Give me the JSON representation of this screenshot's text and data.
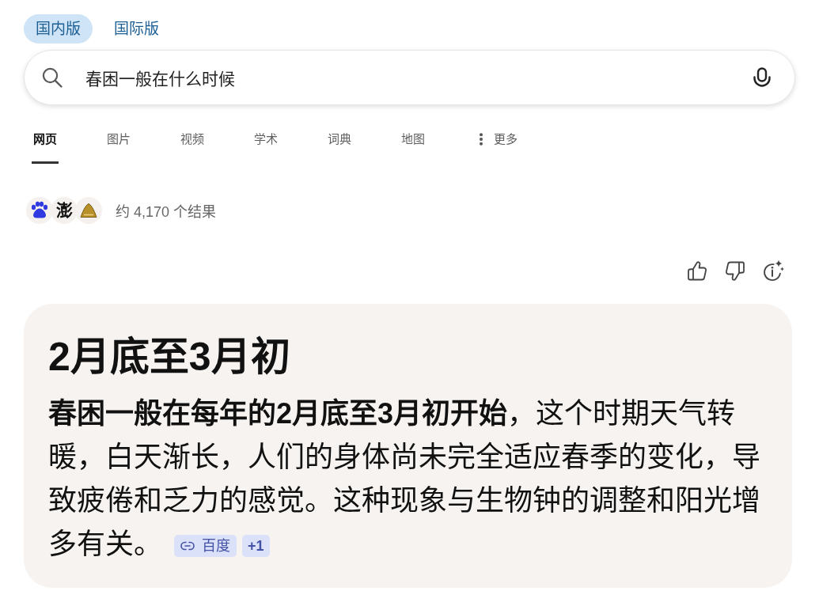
{
  "edition_tabs": [
    {
      "label": "国内版",
      "selected": true
    },
    {
      "label": "国际版",
      "selected": false
    }
  ],
  "search": {
    "value": "春困一般在什么时候"
  },
  "nav_tabs": [
    {
      "label": "网页",
      "selected": true,
      "kind": "plain"
    },
    {
      "label": "图片",
      "selected": false,
      "kind": "plain"
    },
    {
      "label": "视频",
      "selected": false,
      "kind": "plain"
    },
    {
      "label": "学术",
      "selected": false,
      "kind": "plain"
    },
    {
      "label": "词典",
      "selected": false,
      "kind": "plain"
    },
    {
      "label": "地图",
      "selected": false,
      "kind": "plain"
    },
    {
      "label": "更多",
      "selected": false,
      "kind": "menu"
    }
  ],
  "result_summary": {
    "sources": [
      {
        "kind": "paw"
      },
      {
        "kind": "glyph",
        "text": "澎"
      },
      {
        "kind": "mound"
      }
    ],
    "count_text": "约 4,170 个结果"
  },
  "answer": {
    "title": "2月底至3月初",
    "body": "**春困一般在每年的2月底至3月初开始**，这个时期天气转暖，白天渐长，人们的身体尚未完全适应春季的变化，导致疲倦和乏力的感觉。这种现象与生物钟的调整和阳光增多有关。",
    "citations": [
      {
        "kind": "link",
        "label": "百度"
      },
      {
        "kind": "more",
        "label": "+1"
      }
    ]
  }
}
